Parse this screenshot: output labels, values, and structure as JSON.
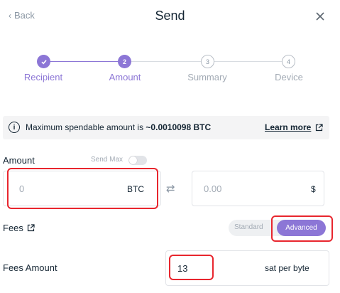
{
  "header": {
    "back_label": "Back",
    "title": "Send"
  },
  "stepper": {
    "steps": [
      {
        "number": "1",
        "label": "Recipient",
        "state": "done"
      },
      {
        "number": "2",
        "label": "Amount",
        "state": "active"
      },
      {
        "number": "3",
        "label": "Summary",
        "state": "todo"
      },
      {
        "number": "4",
        "label": "Device",
        "state": "todo"
      }
    ]
  },
  "banner": {
    "text_prefix": "Maximum spendable amount is ",
    "amount": "~0.0010098 BTC",
    "learn_more": "Learn more"
  },
  "amount": {
    "label": "Amount",
    "send_max_label": "Send Max",
    "send_max_enabled": false,
    "crypto_value": "0",
    "crypto_unit": "BTC",
    "fiat_value": "0.00",
    "fiat_unit": "$"
  },
  "fees": {
    "label": "Fees",
    "mode_standard": "Standard",
    "mode_advanced": "Advanced",
    "selected_mode": "Advanced"
  },
  "fees_amount": {
    "label": "Fees Amount",
    "value": "13",
    "unit": "sat per byte"
  },
  "colors": {
    "accent": "#8c76d6",
    "highlight": "#e8262e",
    "text": "#142533",
    "muted": "#a3abb5"
  }
}
